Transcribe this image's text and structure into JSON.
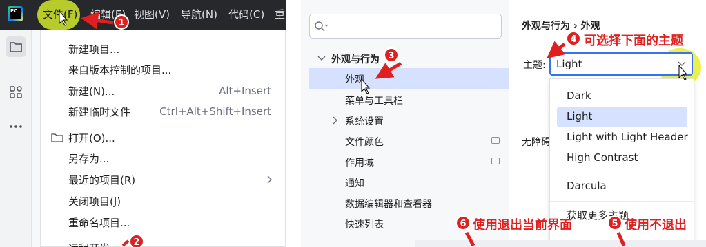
{
  "menubar": {
    "items": [
      {
        "label": "文件(F)"
      },
      {
        "label": "编辑(E)"
      },
      {
        "label": "视图(V)"
      },
      {
        "label": "导航(N)"
      },
      {
        "label": "代码(C)"
      },
      {
        "label": "重"
      }
    ]
  },
  "file_menu": {
    "items": [
      {
        "label": "新建项目...",
        "shortcut": ""
      },
      {
        "label": "来自版本控制的项目...",
        "shortcut": ""
      },
      {
        "label": "新建(N)...",
        "shortcut": "Alt+Insert"
      },
      {
        "label": "新建临时文件",
        "shortcut": "Ctrl+Alt+Shift+Insert"
      },
      {
        "label": "打开(O)...",
        "shortcut": ""
      },
      {
        "label": "另存为...",
        "shortcut": ""
      },
      {
        "label": "最近的项目(R)",
        "shortcut": ""
      },
      {
        "label": "关闭项目(J)",
        "shortcut": ""
      },
      {
        "label": "重命名项目...",
        "shortcut": ""
      },
      {
        "label": "远程开发",
        "shortcut": ""
      }
    ]
  },
  "settings": {
    "search_placeholder": "",
    "tree": [
      {
        "label": "外观与行为"
      },
      {
        "label": "外观"
      },
      {
        "label": "菜单与工具栏"
      },
      {
        "label": "系统设置"
      },
      {
        "label": "文件颜色"
      },
      {
        "label": "作用域"
      },
      {
        "label": "通知"
      },
      {
        "label": "数据编辑器和查看器"
      },
      {
        "label": "快速列表"
      }
    ],
    "breadcrumb": "外观与行为 › 外观",
    "theme_label": "主题:",
    "theme_value": "Light",
    "theme_options": [
      {
        "label": "Dark"
      },
      {
        "label": "Light"
      },
      {
        "label": "Light with Light Header"
      },
      {
        "label": "High Contrast"
      },
      {
        "label": "Darcula"
      },
      {
        "label": "获取更多主题"
      }
    ],
    "accessibility_label": "无障碍"
  },
  "annotations": {
    "a4": "可选择下面的主题",
    "a5": "使用不退出",
    "a6": "使用退出当前界面",
    "n1": "1",
    "n2": "2",
    "n3": "3",
    "n4": "4",
    "n5": "5",
    "n6": "6"
  },
  "colors": {
    "accent": "#3574f0",
    "selection": "#d5e1ff",
    "annotation": "#e02020",
    "highlight": "#c8dd2a",
    "menubar_bg": "#27282c"
  },
  "icons": [
    "pycharm-logo-icon",
    "folder-icon",
    "structure-icon",
    "more-icon",
    "search-icon",
    "chevron-down-icon",
    "chevron-right-icon",
    "project-badge-icon"
  ]
}
